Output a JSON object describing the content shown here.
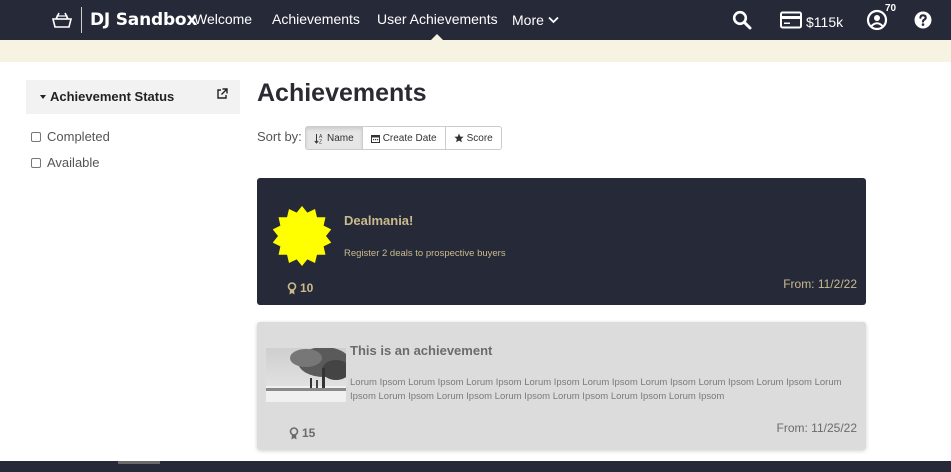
{
  "brand": {
    "name": "DJ Sandbox"
  },
  "nav": {
    "items": [
      "Welcome",
      "Achievements",
      "User Achievements"
    ],
    "more_label": "More",
    "active_index": 2
  },
  "topbar": {
    "cash": "$115k",
    "notification_count": "70"
  },
  "sidebar": {
    "header": "Achievement Status",
    "filters": [
      "Completed",
      "Available"
    ]
  },
  "main": {
    "title": "Achievements",
    "sort_label": "Sort by:",
    "sort_options": [
      "Name",
      "Create Date",
      "Score"
    ],
    "sort_active": "Name"
  },
  "cards": [
    {
      "title": "Dealmania!",
      "description": "Register 2 deals to prospective buyers",
      "points": "10",
      "from": "From: 11/2/22"
    },
    {
      "title": "This is an achievement",
      "description": "Lorum Ipsom Lorum Ipsom Lorum Ipsom Lorum Ipsom Lorum Ipsom Lorum Ipsom Lorum Ipsom Lorum Ipsom Lorum Ipsom Lorum Ipsom Lorum Ipsom Lorum Ipsom Lorum Ipsom Lorum Ipsom Lorum Ipsom",
      "points": "15",
      "from": "From: 11/25/22"
    }
  ],
  "colors": {
    "navbar": "#262938",
    "stripe": "#f6f3e2",
    "badge_yellow": "#ffff00",
    "card_text_gold": "#c9bb8e",
    "card2_bg": "#dcdcdc"
  }
}
